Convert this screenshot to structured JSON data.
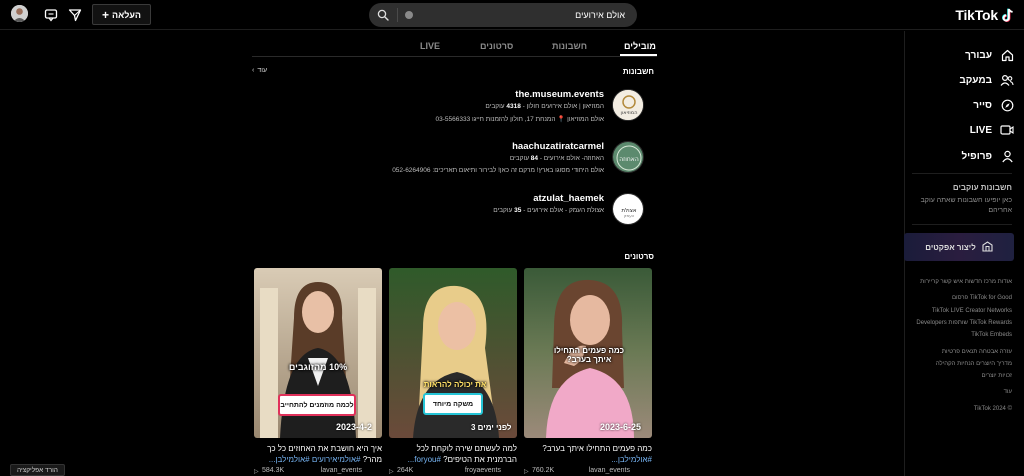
{
  "app": {
    "logo_text": "TikTok"
  },
  "header": {
    "search": {
      "value": "אולם אירועים",
      "placeholder": "חיפוש"
    },
    "upload_label": "העלאה",
    "upload_icon": "plus-icon"
  },
  "sidebar": {
    "nav": [
      {
        "label": "עבורך",
        "icon": "home-icon"
      },
      {
        "label": "במעקב",
        "icon": "users-icon"
      },
      {
        "label": "סייר",
        "icon": "compass-icon"
      },
      {
        "label": "LIVE",
        "icon": "live-icon"
      },
      {
        "label": "פרופיל",
        "icon": "person-icon"
      }
    ],
    "following_heading": "חשבונות עוקבים",
    "following_note": "כאן יופיעו חשבונות שאתה עוקב אחריהם",
    "effects_label": "ליצור אפקטים",
    "footer_links": [
      "אודות  מרכז חדשות  איש קשר  קריירות",
      "TikTok for Good  פרסום",
      "TikTok LIVE Creator Networks",
      "TikTok Rewards  שותפות  Developers",
      "TikTok Embeds",
      "עזרה  אבטחה  תנאים  פרטיות",
      "מדריך היוצרים  הנחיות הקהילה",
      "זכויות יוצרים",
      "עוד",
      "© TikTok 2024"
    ]
  },
  "tabs": [
    {
      "label": "מובילים",
      "active": true
    },
    {
      "label": "חשבונות",
      "active": false
    },
    {
      "label": "סרטונים",
      "active": false
    },
    {
      "label": "LIVE",
      "active": false
    }
  ],
  "accounts_section": {
    "title": "חשבונות",
    "see_more": "עוד",
    "items": [
      {
        "username": "the.museum.events",
        "subtitle_prefix": "המוזיאון | אולם אירועים חולון - ",
        "followers": "4318",
        "followers_label": " עוקבים",
        "bio": "אולם המוזיאון 📍 המנחת 17, חולון להזמנות חייגו 03-5566333",
        "avatar_text": "המוזיאון"
      },
      {
        "username": "haachuzatiratcarmel",
        "subtitle_prefix": "האחוזה- אולם אירועים - ",
        "followers": "84",
        "followers_label": " עוקבים",
        "bio": "אולם היחודי מסוגו בארץ! מרקם זה כאן! לבירור ותיאום תאריכים: 052-6264906",
        "avatar_text": "האחוזה"
      },
      {
        "username": "atzulat_haemek",
        "subtitle_prefix": "אצולת העמק - אולם אירועים - ",
        "followers": "35",
        "followers_label": " עוקבים",
        "bio": "",
        "avatar_text": "אצולת העמק"
      }
    ]
  },
  "videos_section": {
    "title": "סרטונים",
    "items": [
      {
        "date": "2023-6-25",
        "overlay": "כמה פעמים התחילו איתך בערב?",
        "caption_text": "כמה פעמים התחילו איתך בערב? ",
        "caption_tags": "#אולמילבן...",
        "views": "760.2K",
        "author": "lavan_events"
      },
      {
        "date": "לפני ימים 3",
        "overlay": "את יכולה להראות",
        "sticker": "משקה מיוחד",
        "caption_text": "למה לעשתם שירה לוקחת לכל הברמנית את הטיפים? ",
        "caption_tags": "#foryou...",
        "views": "264K",
        "author": "froyaevents"
      },
      {
        "date": "2023-4-2",
        "overlay": "10% מהזוגבים",
        "sticker": "לכמה מוזמנים להתחייב",
        "caption_text": "איך היא חושבת את האחוזים כל כך מהר? ",
        "caption_tags": "#אולמיאירועים #אולמילבן...",
        "views": "584.3K",
        "author": "lavan_events"
      }
    ]
  },
  "get_app_label": "הורד אפליקציה",
  "colors": {
    "accent_link": "#76b4f3",
    "tiktok_cyan": "#25f4ee",
    "tiktok_red": "#fe2c55"
  }
}
